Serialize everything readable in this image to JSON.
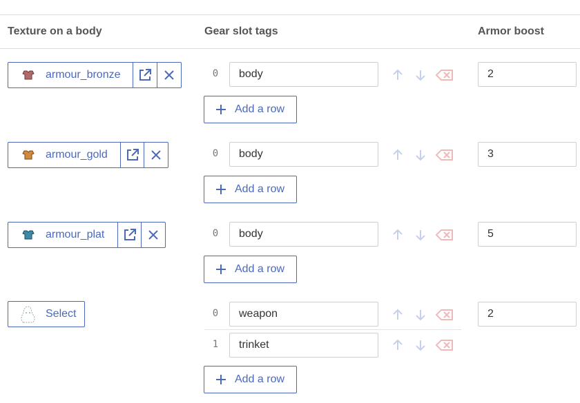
{
  "columns": {
    "texture": "Texture on a body",
    "tags": "Gear slot tags",
    "armor": "Armor boost"
  },
  "colors": {
    "accent": "#4a69bd",
    "control_disabled": "#c5d0ea",
    "delete_disabled": "#f2b8b8"
  },
  "rows": [
    {
      "texture": "armour_bronze",
      "thumb_color": "#b06a6a",
      "tags": [
        {
          "index": "0",
          "value": "body"
        }
      ],
      "add_label": "Add a row",
      "armor": "2"
    },
    {
      "texture": "armour_gold",
      "thumb_color": "#d08a3a",
      "tags": [
        {
          "index": "0",
          "value": "body"
        }
      ],
      "add_label": "Add a row",
      "armor": "3"
    },
    {
      "texture": "armour_plat",
      "thumb_color": "#3a8aa8",
      "tags": [
        {
          "index": "0",
          "value": "body"
        }
      ],
      "add_label": "Add a row",
      "armor": "5"
    },
    {
      "select_label": "Select",
      "tags": [
        {
          "index": "0",
          "value": "weapon"
        },
        {
          "index": "1",
          "value": "trinket"
        }
      ],
      "add_label": "Add a row",
      "armor": "2"
    }
  ]
}
